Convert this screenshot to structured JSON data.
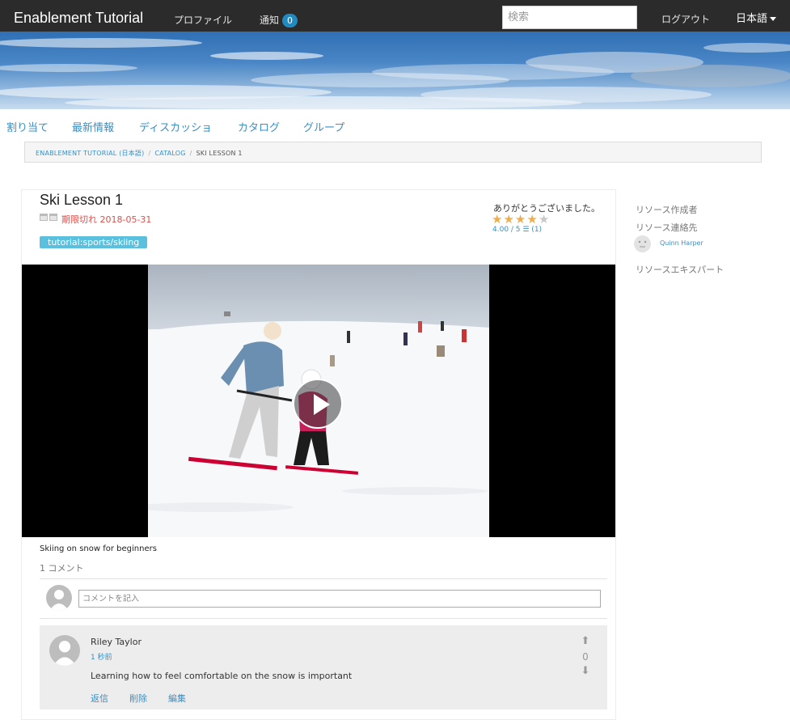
{
  "header": {
    "brand": "Enablement Tutorial",
    "profile": "プロファイル",
    "notifications": "通知",
    "notification_count": "0",
    "search_placeholder": "検索",
    "logout": "ログアウト",
    "language": "日本語"
  },
  "subnav": [
    "割り当て",
    "最新情報",
    "ディスカッショ",
    "カタログ",
    "グループ"
  ],
  "breadcrumb": [
    "ENABLEMENT TUTORIAL (日本語)",
    "CATALOG",
    "SKI LESSON 1"
  ],
  "resource": {
    "title": "Ski Lesson 1",
    "expiry": "期限切れ 2018-05-31",
    "tag": "tutorial:sports/skiing",
    "thanks": "ありがとうございました。",
    "rating": 4,
    "rating_max": 5,
    "rating_text": "4.00 / 5 ☰ (1)",
    "description": "Skiing on snow for beginners",
    "comment_count": "1 コメント",
    "comment_placeholder": "コメントを記入"
  },
  "comment": {
    "author": "Riley Taylor",
    "time": "1 秒前",
    "text": "Learning how to feel comfortable on the snow is important",
    "votes": "0",
    "actions": [
      "返信",
      "削除",
      "編集"
    ]
  },
  "sidebar": {
    "author_label": "リソース作成者",
    "contact_label": "リソース連絡先",
    "contact_name": "Quinn Harper",
    "expert_label": "リソースエキスパート"
  },
  "colors": {
    "topbar": "#2b2b2b",
    "link": "#3a8fc5",
    "badge": "#1e8bc3",
    "tag": "#5bc0de",
    "expired": "#d9534f",
    "star": "#f0ad4e"
  },
  "icons": {
    "play": "play-icon",
    "upvote": "arrow-up-icon",
    "downvote": "arrow-down-icon",
    "avatar": "user-avatar-icon"
  }
}
